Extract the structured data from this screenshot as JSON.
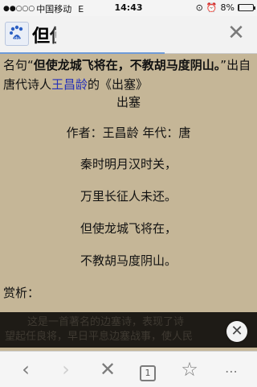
{
  "status_bar": {
    "signal_dots": "●●○○○",
    "carrier": "中国移动",
    "network": "E",
    "time": "14:43",
    "battery": "8%",
    "battery_level": 0.08
  },
  "header": {
    "title": "但使"
  },
  "article": {
    "intro_prefix": "名句“",
    "quote": "但使龙城飞将在，不教胡马度阴山。",
    "intro_middle": "”出自唐代诗人",
    "poet": "王昌龄",
    "intro_suffix": "的《出塞》",
    "poem_title": "出塞",
    "meta": "作者：王昌龄 年代：唐",
    "lines": [
      "秦时明月汉时关，",
      "万里长征人未还。",
      "但使龙城飞将在，",
      "不教胡马度阴山。"
    ],
    "appraisal_label": "赏析："
  },
  "banner": {
    "line1": "这是一首著名的边塞诗，表现了诗",
    "line2": "望起任良将，早日平息边塞战事，使人民"
  },
  "toolbar": {
    "tabs_count": "1"
  },
  "colors": {
    "page_bg": "#c5b697",
    "poet_link": "#2732b8"
  }
}
